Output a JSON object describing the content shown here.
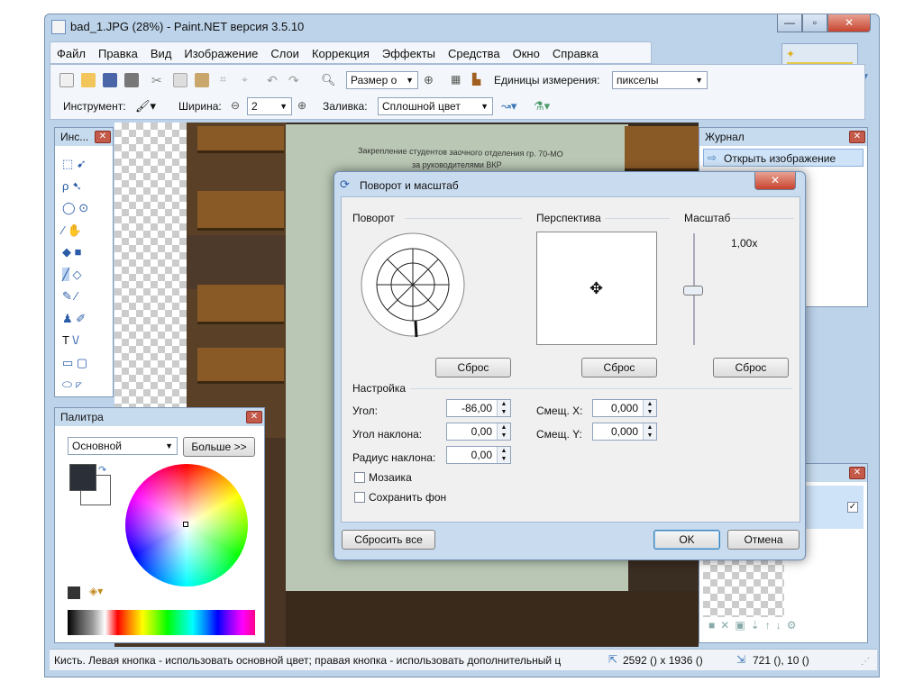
{
  "window": {
    "title": "bad_1.JPG (28%) - Paint.NET версия 3.5.10",
    "controls": {
      "minimize": "—",
      "maximize": "▫",
      "close": "✕"
    }
  },
  "menu": [
    "Файл",
    "Правка",
    "Вид",
    "Изображение",
    "Слои",
    "Коррекция",
    "Эффекты",
    "Средства",
    "Окно",
    "Справка"
  ],
  "toolbar": {
    "zoom_combo": "Размер о",
    "units_label": "Единицы измерения:",
    "units_value": "пикселы",
    "tool_label": "Инструмент:",
    "width_label": "Ширина:",
    "width_value": "2",
    "fill_label": "Заливка:",
    "fill_value": "Сплошной цвет"
  },
  "tools_panel": {
    "title": "Инс..."
  },
  "palette_panel": {
    "title": "Палитра",
    "mode": "Основной",
    "more_button": "Больше >>",
    "primary_color": "#2b2f38",
    "secondary_color": "#ffffff"
  },
  "history_panel": {
    "title": "Журнал",
    "items": [
      "Открыть изображение"
    ]
  },
  "dialog": {
    "title": "Поворот и масштаб",
    "rotation_label": "Поворот",
    "perspective_label": "Перспектива",
    "scale_label": "Масштаб",
    "scale_value": "1,00x",
    "reset": "Сброс",
    "settings_label": "Настройка",
    "angle_label": "Угол:",
    "angle_value": "-86,00",
    "tilt_label": "Угол наклона:",
    "tilt_value": "0,00",
    "tilt_radius_label": "Радиус наклона:",
    "tilt_radius_value": "0,00",
    "offset_x_label": "Смещ. X:",
    "offset_x_value": "0,000",
    "offset_y_label": "Смещ. Y:",
    "offset_y_value": "0,000",
    "tiling_label": "Мозаика",
    "keep_bg_label": "Сохранить фон",
    "reset_all": "Сбросить все",
    "ok": "OK",
    "cancel": "Отмена"
  },
  "document_text": {
    "line1": "Закрепление студентов заочного отделения гр. 70-МО",
    "line2": "за руководителями ВКР"
  },
  "status": {
    "hint": "Кисть. Левая кнопка - использовать основной цвет; правая кнопка - использовать дополнительный ц",
    "image_size": "2592 () x 1936 ()",
    "cursor_pos": "721 (), 10 ()"
  }
}
